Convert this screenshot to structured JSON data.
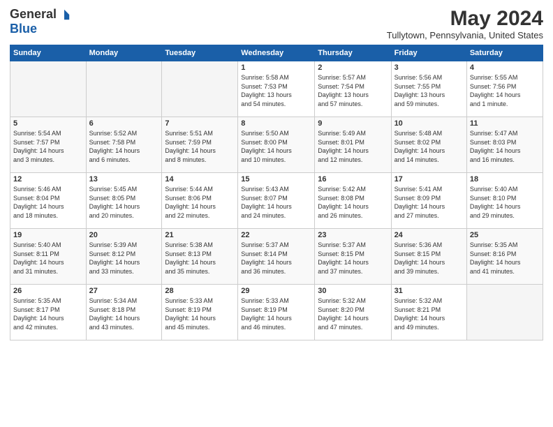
{
  "header": {
    "logo_general": "General",
    "logo_blue": "Blue",
    "month_title": "May 2024",
    "location": "Tullytown, Pennsylvania, United States"
  },
  "weekdays": [
    "Sunday",
    "Monday",
    "Tuesday",
    "Wednesday",
    "Thursday",
    "Friday",
    "Saturday"
  ],
  "weeks": [
    [
      {
        "day": "",
        "info": ""
      },
      {
        "day": "",
        "info": ""
      },
      {
        "day": "",
        "info": ""
      },
      {
        "day": "1",
        "info": "Sunrise: 5:58 AM\nSunset: 7:53 PM\nDaylight: 13 hours\nand 54 minutes."
      },
      {
        "day": "2",
        "info": "Sunrise: 5:57 AM\nSunset: 7:54 PM\nDaylight: 13 hours\nand 57 minutes."
      },
      {
        "day": "3",
        "info": "Sunrise: 5:56 AM\nSunset: 7:55 PM\nDaylight: 13 hours\nand 59 minutes."
      },
      {
        "day": "4",
        "info": "Sunrise: 5:55 AM\nSunset: 7:56 PM\nDaylight: 14 hours\nand 1 minute."
      }
    ],
    [
      {
        "day": "5",
        "info": "Sunrise: 5:54 AM\nSunset: 7:57 PM\nDaylight: 14 hours\nand 3 minutes."
      },
      {
        "day": "6",
        "info": "Sunrise: 5:52 AM\nSunset: 7:58 PM\nDaylight: 14 hours\nand 6 minutes."
      },
      {
        "day": "7",
        "info": "Sunrise: 5:51 AM\nSunset: 7:59 PM\nDaylight: 14 hours\nand 8 minutes."
      },
      {
        "day": "8",
        "info": "Sunrise: 5:50 AM\nSunset: 8:00 PM\nDaylight: 14 hours\nand 10 minutes."
      },
      {
        "day": "9",
        "info": "Sunrise: 5:49 AM\nSunset: 8:01 PM\nDaylight: 14 hours\nand 12 minutes."
      },
      {
        "day": "10",
        "info": "Sunrise: 5:48 AM\nSunset: 8:02 PM\nDaylight: 14 hours\nand 14 minutes."
      },
      {
        "day": "11",
        "info": "Sunrise: 5:47 AM\nSunset: 8:03 PM\nDaylight: 14 hours\nand 16 minutes."
      }
    ],
    [
      {
        "day": "12",
        "info": "Sunrise: 5:46 AM\nSunset: 8:04 PM\nDaylight: 14 hours\nand 18 minutes."
      },
      {
        "day": "13",
        "info": "Sunrise: 5:45 AM\nSunset: 8:05 PM\nDaylight: 14 hours\nand 20 minutes."
      },
      {
        "day": "14",
        "info": "Sunrise: 5:44 AM\nSunset: 8:06 PM\nDaylight: 14 hours\nand 22 minutes."
      },
      {
        "day": "15",
        "info": "Sunrise: 5:43 AM\nSunset: 8:07 PM\nDaylight: 14 hours\nand 24 minutes."
      },
      {
        "day": "16",
        "info": "Sunrise: 5:42 AM\nSunset: 8:08 PM\nDaylight: 14 hours\nand 26 minutes."
      },
      {
        "day": "17",
        "info": "Sunrise: 5:41 AM\nSunset: 8:09 PM\nDaylight: 14 hours\nand 27 minutes."
      },
      {
        "day": "18",
        "info": "Sunrise: 5:40 AM\nSunset: 8:10 PM\nDaylight: 14 hours\nand 29 minutes."
      }
    ],
    [
      {
        "day": "19",
        "info": "Sunrise: 5:40 AM\nSunset: 8:11 PM\nDaylight: 14 hours\nand 31 minutes."
      },
      {
        "day": "20",
        "info": "Sunrise: 5:39 AM\nSunset: 8:12 PM\nDaylight: 14 hours\nand 33 minutes."
      },
      {
        "day": "21",
        "info": "Sunrise: 5:38 AM\nSunset: 8:13 PM\nDaylight: 14 hours\nand 35 minutes."
      },
      {
        "day": "22",
        "info": "Sunrise: 5:37 AM\nSunset: 8:14 PM\nDaylight: 14 hours\nand 36 minutes."
      },
      {
        "day": "23",
        "info": "Sunrise: 5:37 AM\nSunset: 8:15 PM\nDaylight: 14 hours\nand 37 minutes."
      },
      {
        "day": "24",
        "info": "Sunrise: 5:36 AM\nSunset: 8:15 PM\nDaylight: 14 hours\nand 39 minutes."
      },
      {
        "day": "25",
        "info": "Sunrise: 5:35 AM\nSunset: 8:16 PM\nDaylight: 14 hours\nand 41 minutes."
      }
    ],
    [
      {
        "day": "26",
        "info": "Sunrise: 5:35 AM\nSunset: 8:17 PM\nDaylight: 14 hours\nand 42 minutes."
      },
      {
        "day": "27",
        "info": "Sunrise: 5:34 AM\nSunset: 8:18 PM\nDaylight: 14 hours\nand 43 minutes."
      },
      {
        "day": "28",
        "info": "Sunrise: 5:33 AM\nSunset: 8:19 PM\nDaylight: 14 hours\nand 45 minutes."
      },
      {
        "day": "29",
        "info": "Sunrise: 5:33 AM\nSunset: 8:19 PM\nDaylight: 14 hours\nand 46 minutes."
      },
      {
        "day": "30",
        "info": "Sunrise: 5:32 AM\nSunset: 8:20 PM\nDaylight: 14 hours\nand 47 minutes."
      },
      {
        "day": "31",
        "info": "Sunrise: 5:32 AM\nSunset: 8:21 PM\nDaylight: 14 hours\nand 49 minutes."
      },
      {
        "day": "",
        "info": ""
      }
    ]
  ]
}
